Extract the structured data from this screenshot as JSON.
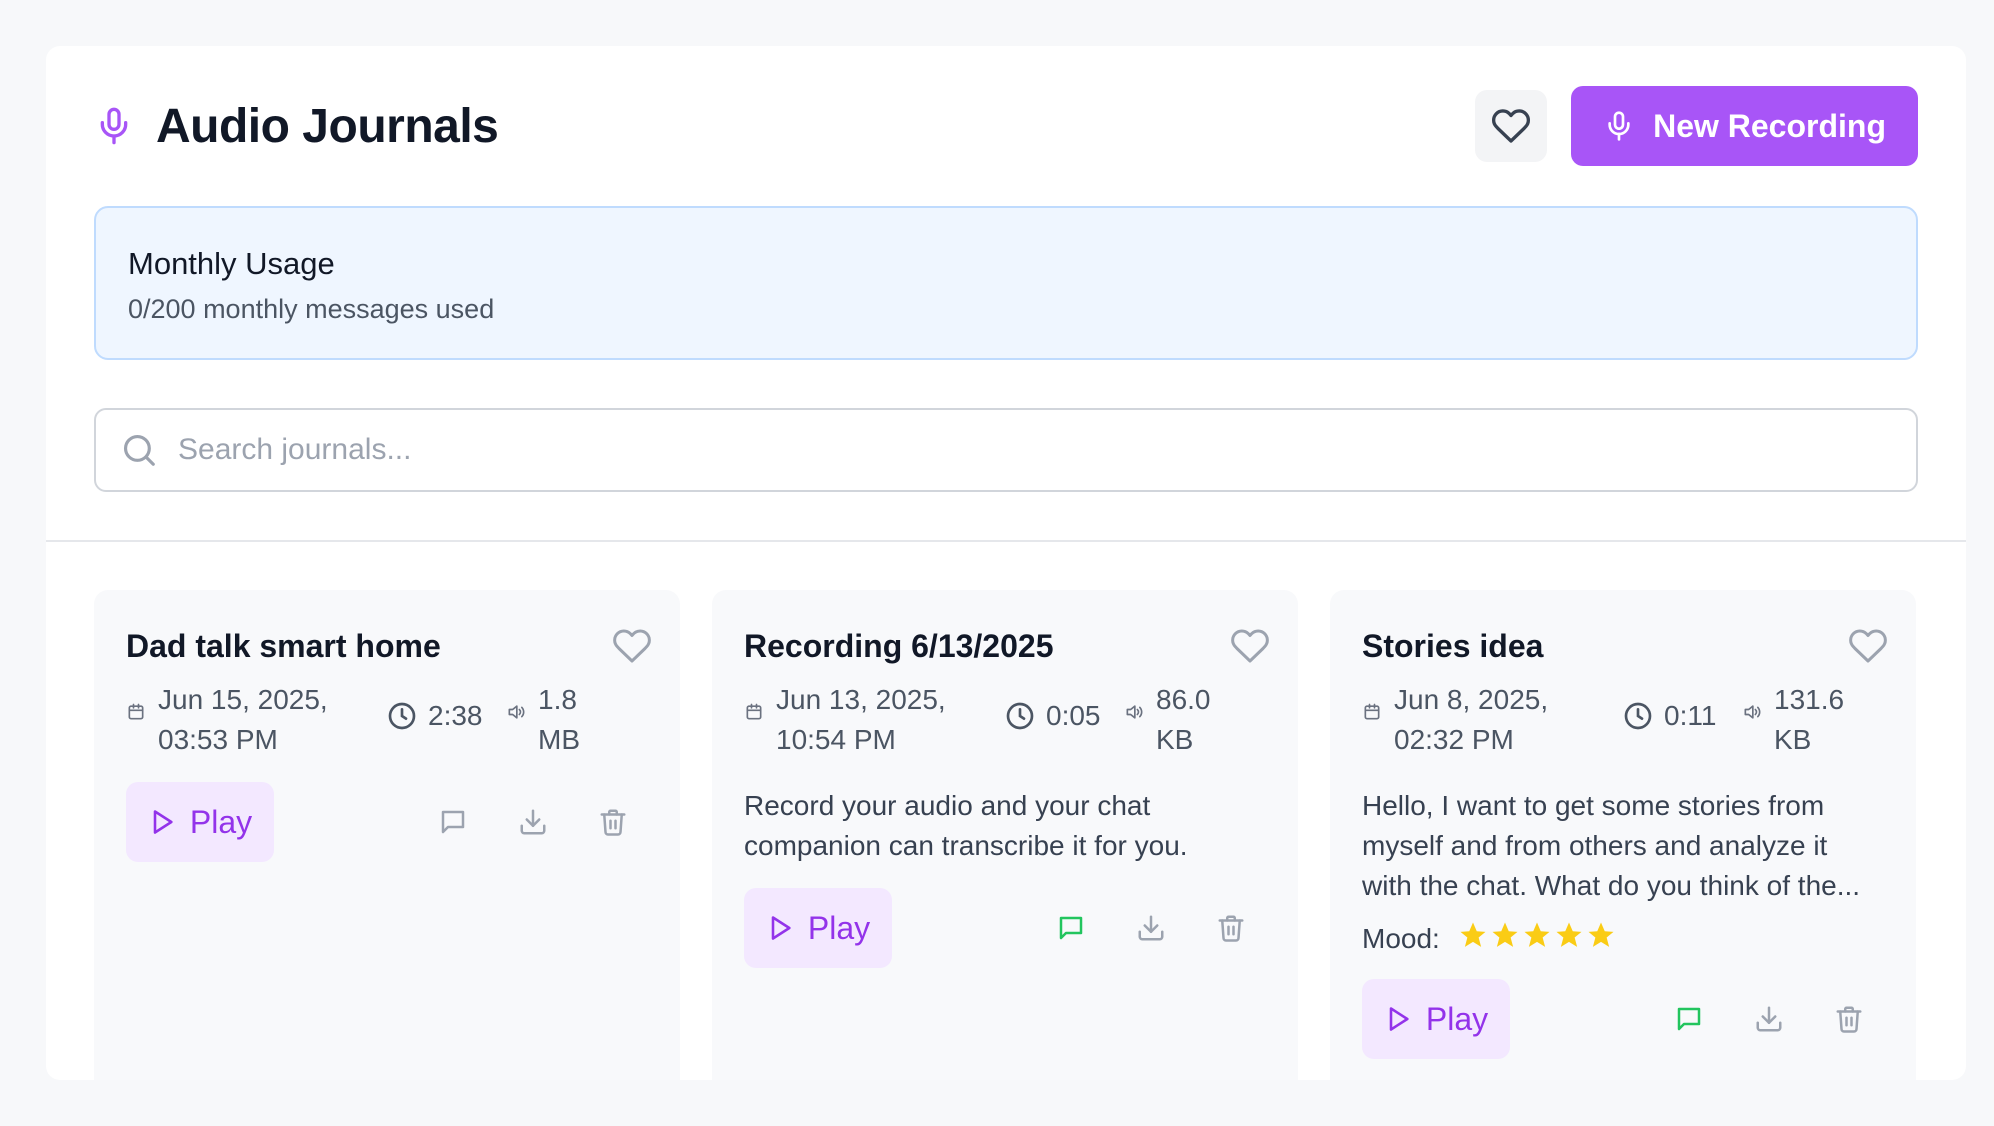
{
  "header": {
    "title": "Audio Journals",
    "new_recording_label": "New Recording",
    "icons": {
      "mic": "microphone-icon",
      "favorites": "heart-icon"
    }
  },
  "usage": {
    "title": "Monthly Usage",
    "subtitle": "0/200 monthly messages used"
  },
  "search": {
    "placeholder": "Search journals..."
  },
  "colors": {
    "accent": "#a855f7",
    "accent_light": "#f3e8ff",
    "accent_text": "#9333ea",
    "chat_active": "#22c55e",
    "star": "#facc15",
    "usage_bg": "#eff6ff",
    "usage_border": "#bfdbfe"
  },
  "play_label": "Play",
  "mood_label": "Mood:",
  "journals": [
    {
      "title": "Dad talk smart home",
      "date_line1": "Jun 15, 2025,",
      "date_line2": "03:53 PM",
      "duration": "2:38",
      "size_line1": "1.8",
      "size_line2": "MB",
      "description": "",
      "mood": null,
      "chat_active": false
    },
    {
      "title": "Recording 6/13/2025",
      "date_line1": "Jun 13, 2025,",
      "date_line2": "10:54 PM",
      "duration": "0:05",
      "size_line1": "86.0",
      "size_line2": "KB",
      "description": "Record your audio and your chat companion can transcribe it for you.",
      "mood": null,
      "chat_active": true
    },
    {
      "title": "Stories idea",
      "date_line1": "Jun 8, 2025,",
      "date_line2": "02:32 PM",
      "duration": "0:11",
      "size_line1": "131.6",
      "size_line2": "KB",
      "description": "Hello, I want to get some stories from myself and from others and analyze it with the chat. What do you think of the...",
      "mood": 5,
      "chat_active": true
    }
  ]
}
